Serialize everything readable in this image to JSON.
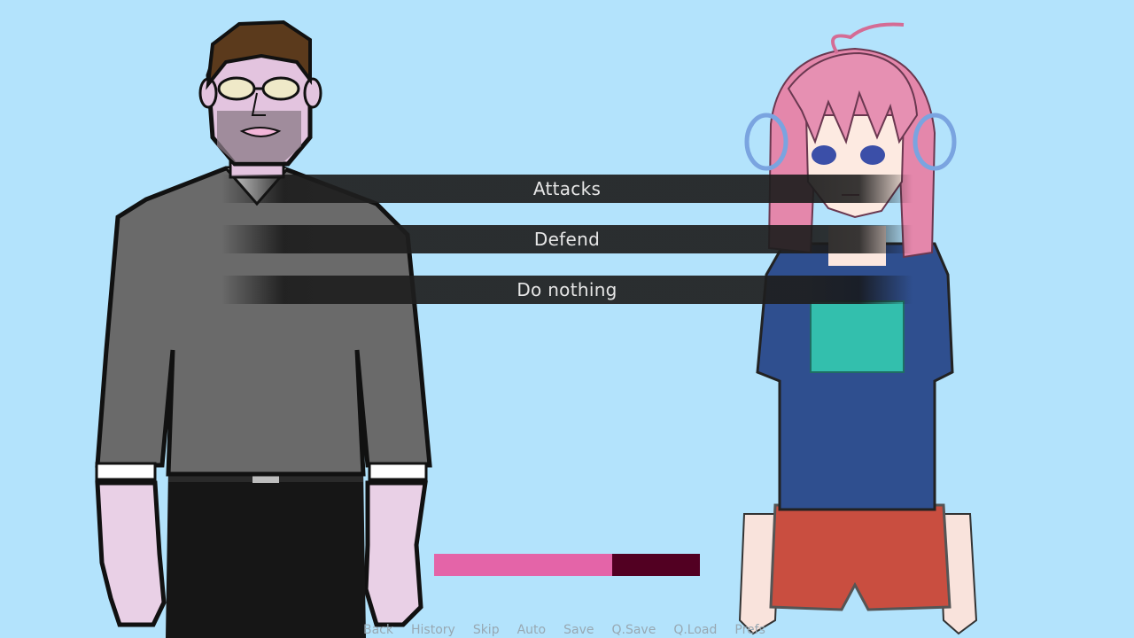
{
  "choices": [
    "Attacks",
    "Defend",
    "Do nothing"
  ],
  "health_bar": {
    "fraction": 0.67,
    "fill_color": "#e464a8",
    "empty_color": "#520022"
  },
  "quick_menu": [
    "Back",
    "History",
    "Skip",
    "Auto",
    "Save",
    "Q.Save",
    "Q.Load",
    "Prefs"
  ],
  "characters": [
    "man-with-glasses",
    "pink-haired-girl"
  ],
  "background_color": "#b3e3fc"
}
